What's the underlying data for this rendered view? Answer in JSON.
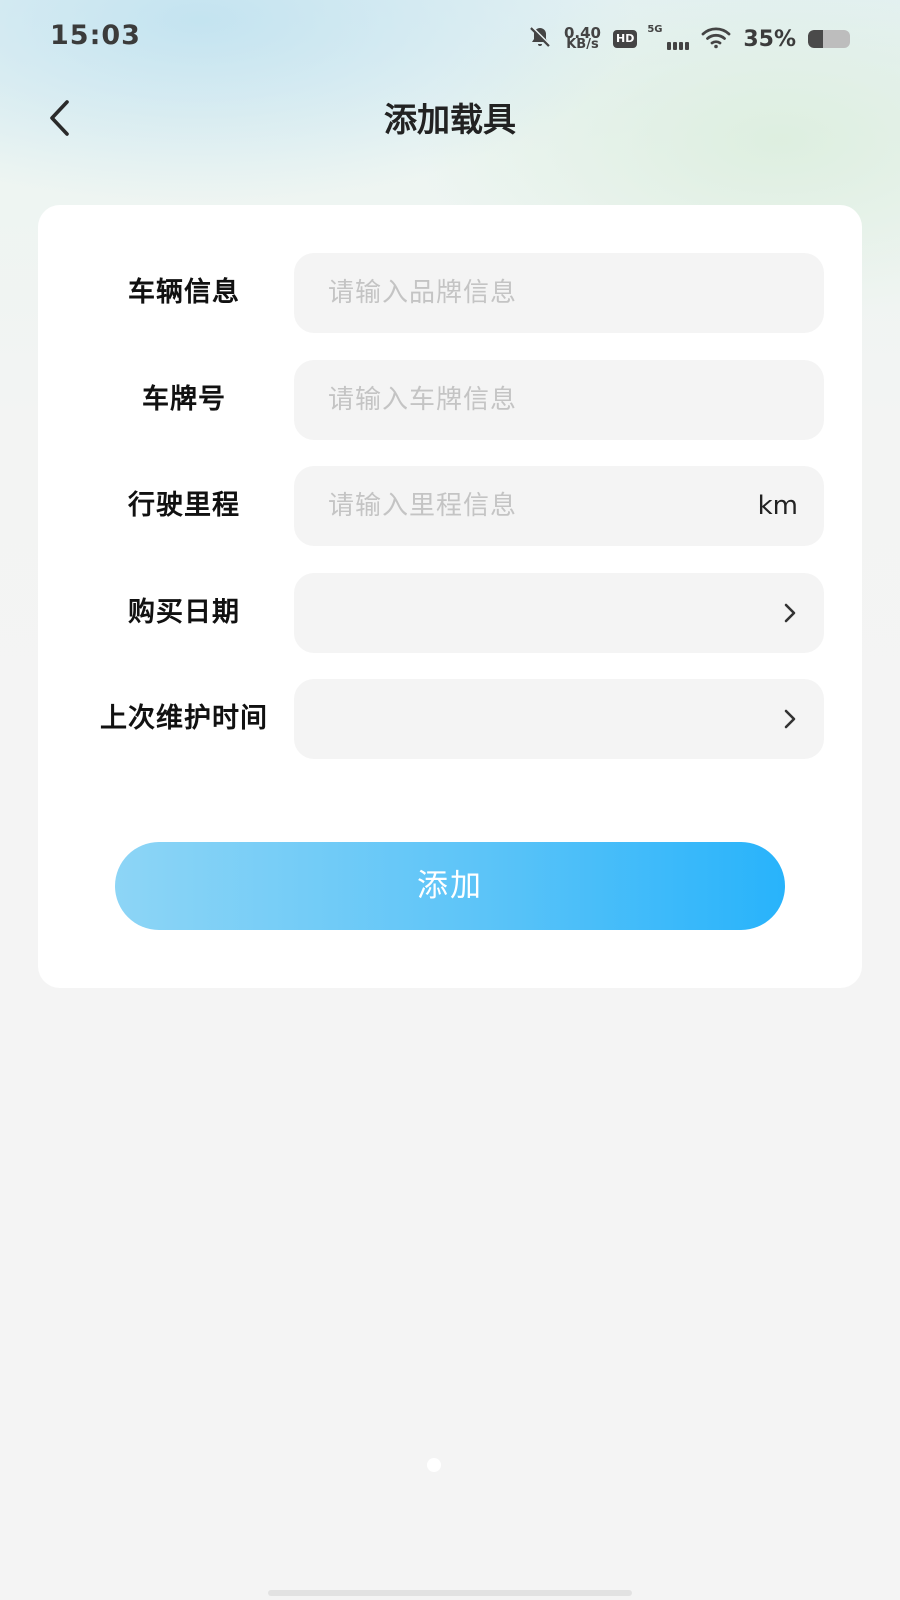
{
  "status_bar": {
    "time": "15:03",
    "net_speed_value": "0.40",
    "net_speed_unit": "KB/s",
    "hd_label": "HD",
    "network_label": "5G",
    "battery_percent": "35%",
    "battery_level": 0.35,
    "icons": [
      "bell-muted-icon",
      "wifi-icon",
      "battery-icon"
    ]
  },
  "header": {
    "title": "添加载具",
    "back_icon": "chevron-left-icon"
  },
  "form": {
    "rows": [
      {
        "label": "车辆信息",
        "placeholder": "请输入品牌信息",
        "value": ""
      },
      {
        "label": "车牌号",
        "placeholder": "请输入车牌信息",
        "value": ""
      },
      {
        "label": "行驶里程",
        "placeholder": "请输入里程信息",
        "value": "",
        "unit": "km"
      },
      {
        "label": "购买日期",
        "value": "",
        "icon": "chevron-right-icon"
      },
      {
        "label": "上次维护时间",
        "value": "",
        "icon": "chevron-right-icon"
      }
    ],
    "submit_label": "添加"
  },
  "colors": {
    "button_gradient_start": "#8dd5f6",
    "button_gradient_end": "#28b3fb",
    "field_background": "#f4f4f4",
    "card_background": "#ffffff"
  }
}
